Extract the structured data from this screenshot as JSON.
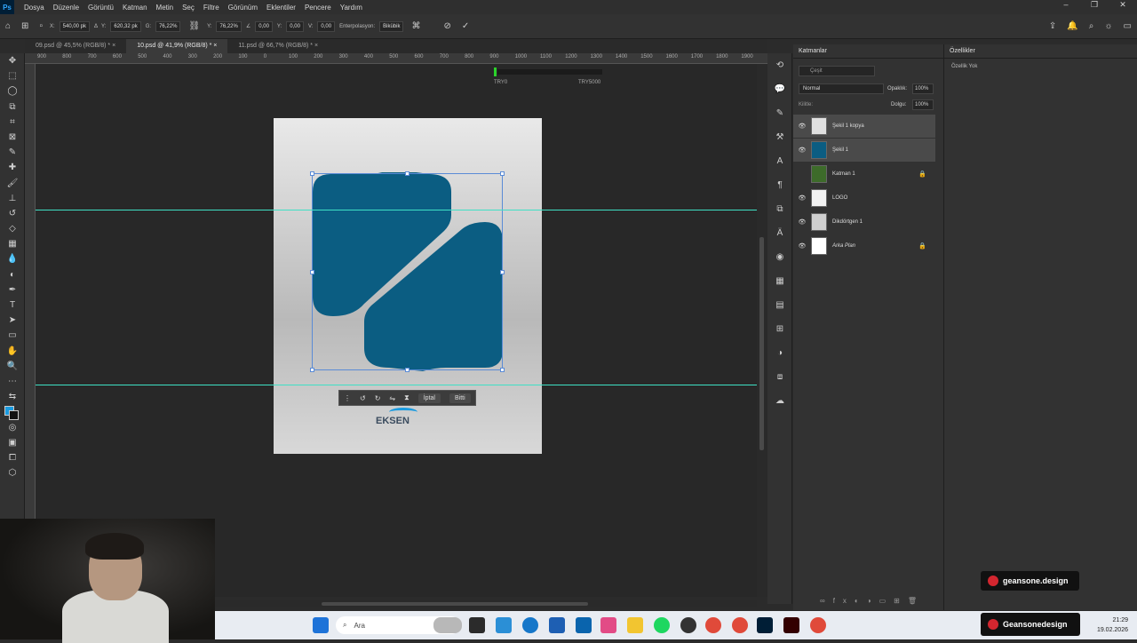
{
  "menubar": {
    "app_icon": "Ps",
    "items": [
      "Dosya",
      "Düzenle",
      "Görüntü",
      "Katman",
      "Metin",
      "Seç",
      "Filtre",
      "Görünüm",
      "Eklentiler",
      "Pencere",
      "Yardım"
    ]
  },
  "options": {
    "x_label": "X:",
    "x_value": "540,00 pk",
    "y_label": "Y:",
    "y_value": "620,32 pk",
    "w_label": "G:",
    "w_value": "76,22%",
    "h_label": "Y:",
    "h_value": "76,22%",
    "angle_value": "0,00",
    "hskew_label": "Y:",
    "hskew_value": "0,00",
    "vskew_label": "V:",
    "vskew_value": "0,00",
    "interp_label": "Enterpolasyon:",
    "interp_value": "Bikübik"
  },
  "tabs": [
    {
      "label": "09.psd @ 45,5% (RGB/8) *"
    },
    {
      "label": "10.psd @ 41,9% (RGB/8) *"
    },
    {
      "label": "11.psd @ 66,7% (RGB/8) *"
    }
  ],
  "ruler_labels": [
    "900",
    "800",
    "700",
    "600",
    "500",
    "400",
    "300",
    "200",
    "100",
    "0",
    "100",
    "200",
    "300",
    "400",
    "500",
    "600",
    "700",
    "800",
    "900",
    "1000",
    "1100",
    "1200",
    "1300",
    "1400",
    "1500",
    "1600",
    "1700",
    "1800",
    "1900"
  ],
  "canvas": {
    "info_top": "TRY0",
    "info_top_right": "TRY5000",
    "context_bar": {
      "cancel": "İptal",
      "done": "Bitti"
    },
    "doc_logo_text": "EKSEN"
  },
  "layers_panel": {
    "title": "Katmanlar",
    "search_placeholder": "Çeşit",
    "blend_mode": "Normal",
    "opacity_label": "Opaklık:",
    "opacity_value": "100%",
    "lock_label": "Kilitle:",
    "fill_label": "Dolgu:",
    "fill_value": "100%",
    "layers": [
      {
        "name": "Şekil 1 kopya",
        "locked": false,
        "visible": true
      },
      {
        "name": "Şekil 1",
        "locked": false,
        "visible": true
      },
      {
        "name": "Katman 1",
        "locked": true,
        "visible": false
      },
      {
        "name": "LOGO",
        "locked": false,
        "visible": true
      },
      {
        "name": "Dikdörtgen 1",
        "locked": false,
        "visible": true
      },
      {
        "name": "Arka Plan",
        "locked": true,
        "visible": true
      }
    ]
  },
  "props_panel": {
    "title": "Özellikler",
    "note": "Özellik Yok"
  },
  "badges": {
    "top": "geansone.design",
    "bottom": "Geansonedesign"
  },
  "taskbar": {
    "search": "Ara",
    "time": "21:29",
    "date": "19.02.2026"
  },
  "colors": {
    "shape": "#0b5d82",
    "guide": "#3fe0c5",
    "accent": "#31a8ff"
  }
}
